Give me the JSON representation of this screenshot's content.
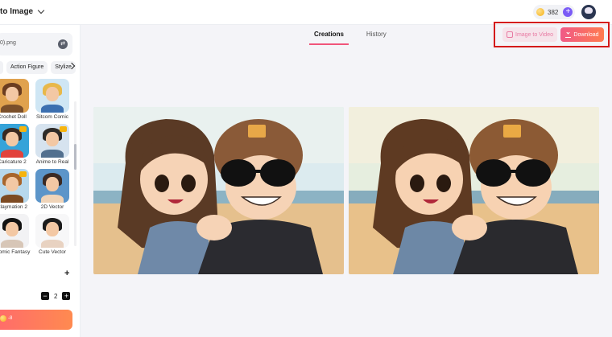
{
  "header": {
    "title": "to Image",
    "credits": "382"
  },
  "sidebar": {
    "file_name": "0).png",
    "style_tabs": [
      "Action Figure",
      "Stylize"
    ],
    "styles": [
      {
        "label": "Crochet Doll",
        "premium": false,
        "colors": [
          "#e0a24e",
          "#6b3d20",
          "#7a4f2a"
        ]
      },
      {
        "label": "Sitcom Comic",
        "premium": false,
        "colors": [
          "#cfe6f4",
          "#e8b84a",
          "#3b6fb0"
        ]
      },
      {
        "label": "Caricature 2",
        "premium": true,
        "colors": [
          "#35a3d9",
          "#3a2a22",
          "#e2423c"
        ]
      },
      {
        "label": "Anime to Real",
        "premium": true,
        "colors": [
          "#d6e3ef",
          "#2e2b28",
          "#52708f"
        ]
      },
      {
        "label": "Claymation 2",
        "premium": true,
        "colors": [
          "#b7d8ec",
          "#a8652c",
          "#7c4a22"
        ]
      },
      {
        "label": "2D Vector",
        "premium": false,
        "colors": [
          "#5c95c9",
          "#3b2a24",
          "#f0d4b8"
        ]
      },
      {
        "label": "Comic Fantasy",
        "premium": false,
        "colors": [
          "#f2f2f4",
          "#131313",
          "#d7c6b7"
        ]
      },
      {
        "label": "Cute Vector",
        "premium": false,
        "colors": [
          "#f7f7f8",
          "#1c1c1c",
          "#e8d2c1"
        ]
      },
      {
        "label": "",
        "premium": true,
        "colors": [
          "#e8a46a",
          "#a4562c",
          "#d07a40"
        ]
      },
      {
        "label": "",
        "premium": false,
        "colors": [
          "#bfcf8e",
          "#6e8a3c",
          "#a3b46a"
        ]
      }
    ],
    "quantity": "2",
    "generate_cost": "-8"
  },
  "main": {
    "tabs": [
      "Creations",
      "History"
    ],
    "image_to_video_label": "Image to Video",
    "download_label": "Download"
  },
  "colors": {
    "accent": "#f0547a",
    "download_gradient": [
      "#f05a87",
      "#ff7a4e"
    ],
    "highlight": "#d41a1a"
  }
}
